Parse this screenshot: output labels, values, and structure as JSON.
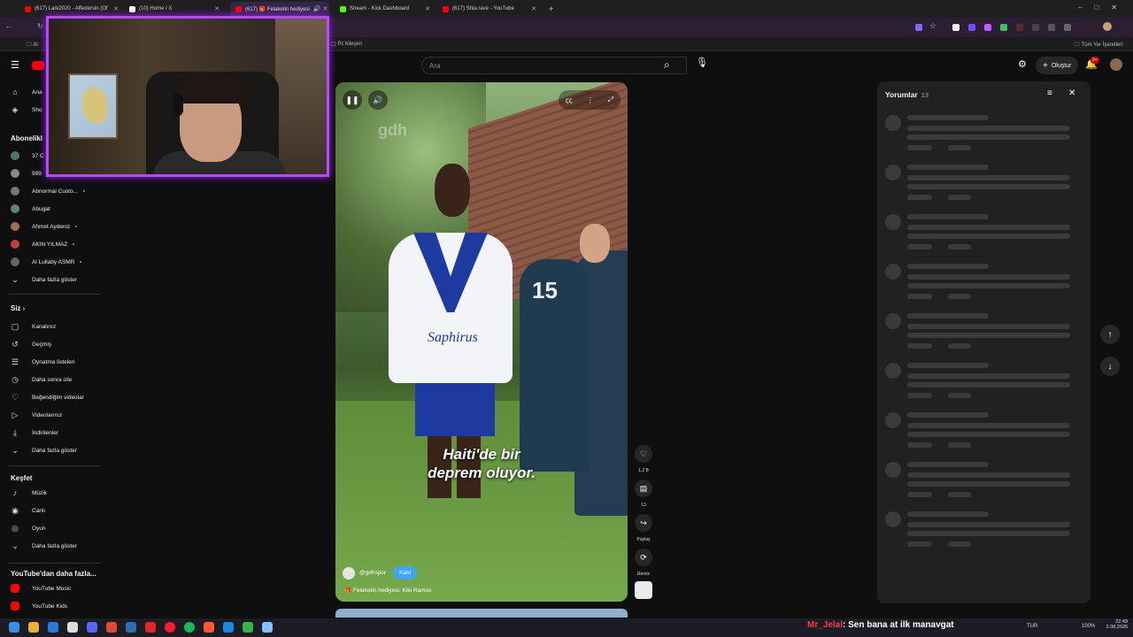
{
  "browser": {
    "tabs": [
      {
        "label": "(617) Lark2020 - Affedersin (Of",
        "active": false,
        "color": "#ff0000"
      },
      {
        "label": "(10) Home / X",
        "active": false,
        "color": "#ffffff"
      },
      {
        "label": "(617) 🎁 Felaketin hediyesi",
        "active": true,
        "color": "#ff0000"
      },
      {
        "label": "Stream - Kick Dashboard",
        "active": false,
        "color": "#53fc18"
      },
      {
        "label": "(617) Shia rave - YouTube",
        "active": false,
        "color": "#ff0000"
      }
    ],
    "bookmarks": {
      "left": "Al",
      "pc": "Pc bileşen",
      "all": "Tüm Yer İşaretleri"
    }
  },
  "youtube": {
    "search_placeholder": "Ara",
    "create_label": "Oluştur",
    "notif_badge": "9+"
  },
  "sidebar": {
    "top": [
      {
        "label": "Ana",
        "icon": "home-icon"
      },
      {
        "label": "Sho",
        "icon": "shorts-icon"
      }
    ],
    "subs_heading": "Abonelikl",
    "subs": [
      {
        "label": "37 C",
        "color": "#4a7a5a",
        "dot": false
      },
      {
        "label": "999",
        "color": "#8a8a8a",
        "dot": false
      },
      {
        "label": "Abnormal Custo...",
        "color": "#777777",
        "dot": true
      },
      {
        "label": "Abugat",
        "color": "#5a8a6a",
        "dot": false
      },
      {
        "label": "Ahmet Aydeniz",
        "color": "#a07050",
        "dot": true
      },
      {
        "label": "AKIN YILMAZ",
        "color": "#c04040",
        "dot": true
      },
      {
        "label": "Al Lullaby ASMR",
        "color": "#666666",
        "dot": true
      }
    ],
    "show_more": "Daha fazla göster",
    "you_heading": "Siz",
    "you_items": [
      {
        "label": "Kanalınız",
        "icon": "channel-icon",
        "glyph": "▢"
      },
      {
        "label": "Geçmiş",
        "icon": "history-icon",
        "glyph": "↺"
      },
      {
        "label": "Oynatma listeleri",
        "icon": "playlists-icon",
        "glyph": "☰"
      },
      {
        "label": "Daha sonra izle",
        "icon": "watch-later-icon",
        "glyph": "◷"
      },
      {
        "label": "Beğendiğim videolar",
        "icon": "liked-icon",
        "glyph": "♡"
      },
      {
        "label": "Videolarınız",
        "icon": "your-videos-icon",
        "glyph": "▷"
      },
      {
        "label": "İndirilenler",
        "icon": "downloads-icon",
        "glyph": "⤓"
      },
      {
        "label": "Daha fazla göster",
        "icon": "chevron-down-icon",
        "glyph": "⌄"
      }
    ],
    "explore_heading": "Keşfet",
    "explore_items": [
      {
        "label": "Müzik",
        "icon": "music-icon",
        "glyph": "♪"
      },
      {
        "label": "Canlı",
        "icon": "live-icon",
        "glyph": "◉"
      },
      {
        "label": "Oyun",
        "icon": "gaming-icon",
        "glyph": "◎"
      },
      {
        "label": "Daha fazla göster",
        "icon": "chevron-down-icon",
        "glyph": "⌄"
      }
    ],
    "more_heading": "YouTube'dan daha fazla...",
    "more_items": [
      {
        "label": "YouTube Music",
        "color": "#ff0000"
      },
      {
        "label": "YouTube Kids",
        "color": "#ff0000"
      }
    ]
  },
  "video": {
    "caption_line1": "Haiti'de bir",
    "caption_line2": "deprem oluyor.",
    "watermark": "gdh",
    "jersey_number": "15",
    "sponsor": "Saphirus",
    "channel": "@gdhspor",
    "subscribe": "Katıl",
    "title": "🎁 Felaketin hediyesi: Kiki Ramos"
  },
  "actions": {
    "likes": "1,2 B",
    "comments": "13",
    "share": "Paylaş",
    "remix": "Remix"
  },
  "comments_panel": {
    "title": "Yorumlar",
    "count": "13"
  },
  "taskbar": {
    "chat_user": "Mr_Jelal",
    "chat_text": ": Sen bana at ilk manavgat",
    "lang": "TUR",
    "battery": "100%",
    "time": "22:49",
    "date": "2.08.2026"
  }
}
